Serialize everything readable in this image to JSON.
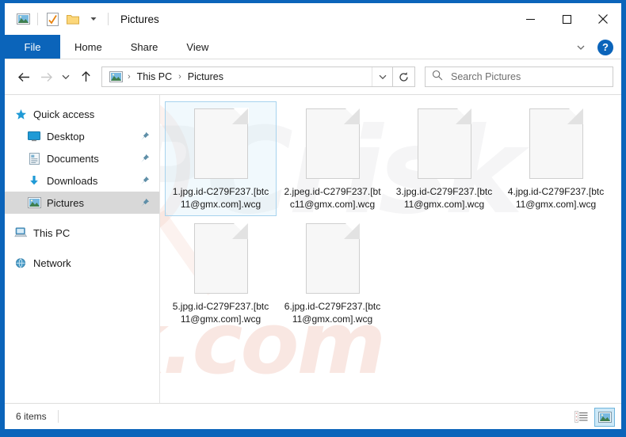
{
  "window": {
    "title": "Pictures",
    "quick_access_icons": [
      "picture-icon",
      "properties-checkmark-icon",
      "new-folder-icon",
      "customize-dropdown-icon"
    ],
    "controls": {
      "minimize": "—",
      "maximize": "☐",
      "close": "✕"
    }
  },
  "ribbon": {
    "tabs": [
      {
        "label": "File",
        "active": true
      },
      {
        "label": "Home",
        "active": false
      },
      {
        "label": "Share",
        "active": false
      },
      {
        "label": "View",
        "active": false
      }
    ],
    "collapse_icon": "chevron-down-icon",
    "help_label": "?"
  },
  "navbar": {
    "back_icon": "arrow-left-icon",
    "forward_icon": "arrow-right-icon",
    "recent_icon": "chevron-down-icon",
    "up_icon": "arrow-up-icon",
    "breadcrumb": {
      "root_icon": "pictures-folder-icon",
      "items": [
        "This PC",
        "Pictures"
      ],
      "separator": "›"
    },
    "address_dropdown_icon": "chevron-down-icon",
    "refresh_icon": "refresh-icon"
  },
  "search": {
    "icon": "search-icon",
    "placeholder": "Search Pictures"
  },
  "sidebar": {
    "items": [
      {
        "label": "Quick access",
        "icon": "star-icon",
        "level": 0,
        "pinned": false,
        "selected": false
      },
      {
        "label": "Desktop",
        "icon": "desktop-icon",
        "level": 1,
        "pinned": true,
        "selected": false
      },
      {
        "label": "Documents",
        "icon": "documents-icon",
        "level": 1,
        "pinned": true,
        "selected": false
      },
      {
        "label": "Downloads",
        "icon": "downloads-icon",
        "level": 1,
        "pinned": true,
        "selected": false
      },
      {
        "label": "Pictures",
        "icon": "pictures-icon",
        "level": 1,
        "pinned": true,
        "selected": true
      },
      {
        "label": "This PC",
        "icon": "this-pc-icon",
        "level": 0,
        "pinned": false,
        "selected": false
      },
      {
        "label": "Network",
        "icon": "network-icon",
        "level": 0,
        "pinned": false,
        "selected": false
      }
    ]
  },
  "files": [
    {
      "name": "1.jpg.id-C279F237.[btc11@gmx.com].wcg",
      "selected": true
    },
    {
      "name": "2.jpeg.id-C279F237.[btc11@gmx.com].wcg",
      "selected": false
    },
    {
      "name": "3.jpg.id-C279F237.[btc11@gmx.com].wcg",
      "selected": false
    },
    {
      "name": "4.jpg.id-C279F237.[btc11@gmx.com].wcg",
      "selected": false
    },
    {
      "name": "5.jpg.id-C279F237.[btc11@gmx.com].wcg",
      "selected": false
    },
    {
      "name": "6.jpg.id-C279F237.[btc11@gmx.com].wcg",
      "selected": false
    }
  ],
  "statusbar": {
    "item_count": "6 items",
    "views": [
      {
        "icon": "details-view-icon",
        "active": false
      },
      {
        "icon": "large-icons-view-icon",
        "active": true
      }
    ]
  },
  "watermark": {
    "gray_text": "PCrisk",
    "pink_text": "risk.com",
    "magnifier_icon": "magnifier-watermark-icon"
  },
  "colors": {
    "accent": "#0b64ba",
    "frame": "#0b64ba",
    "selection_border": "#a7d3ee",
    "sidebar_selected": "#d8d8d8"
  }
}
